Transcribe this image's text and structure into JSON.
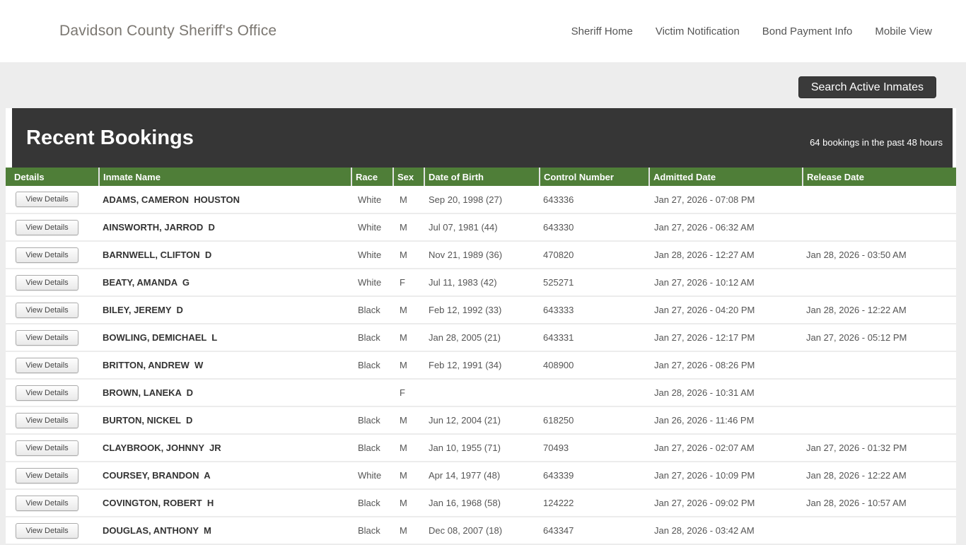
{
  "header": {
    "brand": "Davidson County Sheriff's Office",
    "nav": [
      {
        "label": "Sheriff Home"
      },
      {
        "label": "Victim Notification"
      },
      {
        "label": "Bond Payment Info"
      },
      {
        "label": "Mobile View"
      }
    ]
  },
  "toolbar": {
    "search_button_label": "Search Active Inmates"
  },
  "bookings": {
    "title": "Recent Bookings",
    "subtitle": "64 bookings in the past 48 hours",
    "view_details_label": "View Details",
    "columns": [
      "Details",
      "Inmate Name",
      "Race",
      "Sex",
      "Date of Birth",
      "Control Number",
      "Admitted Date",
      "Release Date"
    ],
    "rows": [
      {
        "name": "ADAMS, CAMERON  HOUSTON",
        "race": "White",
        "sex": "M",
        "dob": "Sep 20, 1998 (27)",
        "control": "643336",
        "admitted": "Jan 27, 2026 - 07:08 PM",
        "released": ""
      },
      {
        "name": "AINSWORTH, JARROD  D",
        "race": "White",
        "sex": "M",
        "dob": "Jul 07, 1981 (44)",
        "control": "643330",
        "admitted": "Jan 27, 2026 - 06:32 AM",
        "released": ""
      },
      {
        "name": "BARNWELL, CLIFTON  D",
        "race": "White",
        "sex": "M",
        "dob": "Nov 21, 1989 (36)",
        "control": "470820",
        "admitted": "Jan 28, 2026 - 12:27 AM",
        "released": "Jan 28, 2026 - 03:50 AM"
      },
      {
        "name": "BEATY, AMANDA  G",
        "race": "White",
        "sex": "F",
        "dob": "Jul 11, 1983 (42)",
        "control": "525271",
        "admitted": "Jan 27, 2026 - 10:12 AM",
        "released": ""
      },
      {
        "name": "BILEY, JEREMY  D",
        "race": "Black",
        "sex": "M",
        "dob": "Feb 12, 1992 (33)",
        "control": "643333",
        "admitted": "Jan 27, 2026 - 04:20 PM",
        "released": "Jan 28, 2026 - 12:22 AM"
      },
      {
        "name": "BOWLING, DEMICHAEL  L",
        "race": "Black",
        "sex": "M",
        "dob": "Jan 28, 2005 (21)",
        "control": "643331",
        "admitted": "Jan 27, 2026 - 12:17 PM",
        "released": "Jan 27, 2026 - 05:12 PM"
      },
      {
        "name": "BRITTON, ANDREW  W",
        "race": "Black",
        "sex": "M",
        "dob": "Feb 12, 1991 (34)",
        "control": "408900",
        "admitted": "Jan 27, 2026 - 08:26 PM",
        "released": ""
      },
      {
        "name": "BROWN, LANEKA  D",
        "race": "",
        "sex": "F",
        "dob": "",
        "control": "",
        "admitted": "Jan 28, 2026 - 10:31 AM",
        "released": ""
      },
      {
        "name": "BURTON, NICKEL  D",
        "race": "Black",
        "sex": "M",
        "dob": "Jun 12, 2004 (21)",
        "control": "618250",
        "admitted": "Jan 26, 2026 - 11:46 PM",
        "released": ""
      },
      {
        "name": "CLAYBROOK, JOHNNY  JR",
        "race": "Black",
        "sex": "M",
        "dob": "Jan 10, 1955 (71)",
        "control": "70493",
        "admitted": "Jan 27, 2026 - 02:07 AM",
        "released": "Jan 27, 2026 - 01:32 PM"
      },
      {
        "name": "COURSEY, BRANDON  A",
        "race": "White",
        "sex": "M",
        "dob": "Apr 14, 1977 (48)",
        "control": "643339",
        "admitted": "Jan 27, 2026 - 10:09 PM",
        "released": "Jan 28, 2026 - 12:22 AM"
      },
      {
        "name": "COVINGTON, ROBERT  H",
        "race": "Black",
        "sex": "M",
        "dob": "Jan 16, 1968 (58)",
        "control": "124222",
        "admitted": "Jan 27, 2026 - 09:02 PM",
        "released": "Jan 28, 2026 - 10:57 AM"
      },
      {
        "name": "DOUGLAS, ANTHONY  M",
        "race": "Black",
        "sex": "M",
        "dob": "Dec 08, 2007 (18)",
        "control": "643347",
        "admitted": "Jan 28, 2026 - 03:42 AM",
        "released": ""
      }
    ]
  },
  "colors": {
    "table_header_green": "#4f7e38",
    "banner_dark": "#363636",
    "search_button_dark": "#3a3a3a"
  }
}
